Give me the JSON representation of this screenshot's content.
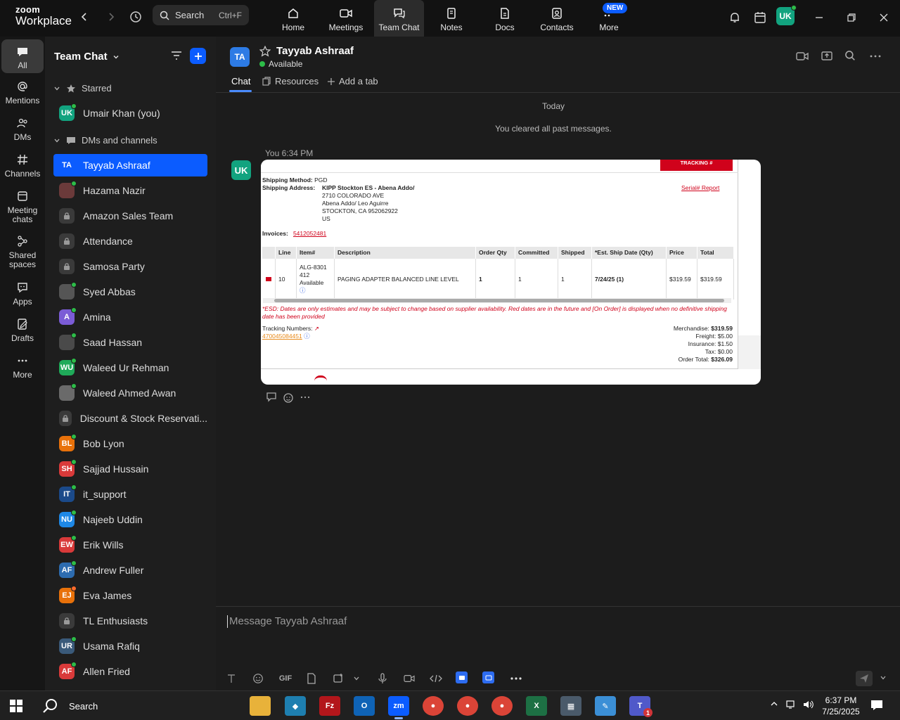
{
  "topbar": {
    "logo_line1": "zoom",
    "logo_line2": "Workplace",
    "search_label": "Search",
    "search_shortcut": "Ctrl+F",
    "tabs": [
      {
        "label": "Home",
        "icon": "home-icon"
      },
      {
        "label": "Meetings",
        "icon": "video-icon"
      },
      {
        "label": "Team Chat",
        "icon": "chat-icon"
      },
      {
        "label": "Notes",
        "icon": "notes-icon"
      },
      {
        "label": "Docs",
        "icon": "docs-icon"
      },
      {
        "label": "Contacts",
        "icon": "contacts-icon"
      },
      {
        "label": "More",
        "icon": "more-icon"
      }
    ],
    "new_badge": "NEW",
    "user_initials": "UK",
    "brand_color": "#0b5cff"
  },
  "rail": [
    {
      "label": "All"
    },
    {
      "label": "Mentions"
    },
    {
      "label": "DMs"
    },
    {
      "label": "Channels"
    },
    {
      "label": "Meeting chats"
    },
    {
      "label": "Shared spaces"
    },
    {
      "label": "Apps"
    },
    {
      "label": "Drafts"
    },
    {
      "label": "More"
    }
  ],
  "sidebar": {
    "title": "Team Chat",
    "starred_label": "Starred",
    "dms_label": "DMs and channels",
    "starred_item": {
      "name": "Umair Khan (you)",
      "initials": "UK",
      "color": "#12a37f"
    },
    "items": [
      {
        "name": "Tayyab Ashraaf",
        "initials": "TA",
        "color": "#0b5cff",
        "type": "avatar",
        "selected": true
      },
      {
        "name": "Hazama Nazir",
        "initials": "",
        "color": "#6b3a3a",
        "type": "photo"
      },
      {
        "name": "Amazon Sales Team",
        "type": "lock"
      },
      {
        "name": "Attendance",
        "type": "lock"
      },
      {
        "name": "Samosa Party",
        "type": "lock"
      },
      {
        "name": "Syed Abbas",
        "initials": "",
        "color": "#555",
        "type": "photo"
      },
      {
        "name": "Amina",
        "initials": "A",
        "color": "#7b5cd6",
        "type": "avatar"
      },
      {
        "name": "Saad Hassan",
        "initials": "",
        "color": "#4a4a4a",
        "type": "photo"
      },
      {
        "name": "Waleed Ur Rehman",
        "initials": "WU",
        "color": "#1faa59",
        "type": "avatar"
      },
      {
        "name": "Waleed Ahmed Awan",
        "initials": "",
        "color": "#6a6a6a",
        "type": "photo"
      },
      {
        "name": "Discount & Stock Reservati...",
        "type": "lock"
      },
      {
        "name": "Bob Lyon",
        "initials": "BL",
        "color": "#e8710a",
        "type": "avatar"
      },
      {
        "name": "Sajjad Hussain",
        "initials": "SH",
        "color": "#d93a3a",
        "type": "avatar"
      },
      {
        "name": "it_support",
        "initials": "IT",
        "color": "#1b4a8a",
        "type": "photo"
      },
      {
        "name": "Najeeb Uddin",
        "initials": "NU",
        "color": "#1e88e5",
        "type": "avatar"
      },
      {
        "name": "Erik Wills",
        "initials": "EW",
        "color": "#d93a3a",
        "type": "avatar"
      },
      {
        "name": "Andrew Fuller",
        "initials": "AF",
        "color": "#2d6cb0",
        "type": "avatar"
      },
      {
        "name": "Eva James",
        "initials": "EJ",
        "color": "#e8710a",
        "type": "avatar",
        "status": "orange"
      },
      {
        "name": "TL Enthusiasts",
        "type": "lock"
      },
      {
        "name": "Usama Rafiq",
        "initials": "UR",
        "color": "#3a5a7a",
        "type": "avatar"
      },
      {
        "name": "Allen Fried",
        "initials": "AF",
        "color": "#d93a3a",
        "type": "avatar"
      }
    ]
  },
  "chat": {
    "contact_name": "Tayyab Ashraaf",
    "contact_initials": "TA",
    "status": "Available",
    "tabs": [
      "Chat",
      "Resources",
      "Add a tab"
    ],
    "day_label": "Today",
    "cleared_notice": "You cleared all past messages.",
    "message_meta": "You 6:34 PM",
    "sender_initials": "UK",
    "composer_placeholder": "Message Tayyab Ashraaf"
  },
  "order": {
    "tracking_btn": "TRACKING #",
    "shipping_method_label": "Shipping Method:",
    "shipping_method": "PGD",
    "shipping_address_label": "Shipping Address:",
    "address_line1": "KIPP Stockton ES - Abena Addo/",
    "address_line2": "2710 COLORADO AVE",
    "address_line3": "Abena Addo/ Leo Aguirre",
    "address_line4": "STOCKTON, CA 952062922",
    "address_line5": "US",
    "serial_report": "Serial# Report",
    "invoices_label": "Invoices:",
    "invoice_no": "5412052481",
    "headers": [
      "Line",
      "Item#",
      "Description",
      "Order Qty",
      "Committed",
      "Shipped",
      "*Est. Ship Date (Qty)",
      "Price",
      "Total"
    ],
    "row": {
      "line": "10",
      "item_l1": "ALG-8301",
      "item_l2": "412",
      "item_l3": "Available",
      "description": "PAGING ADAPTER BALANCED LINE LEVEL",
      "order_qty": "1",
      "committed": "1",
      "shipped": "1",
      "ship_date": "7/24/25 (1)",
      "price": "$319.59",
      "total": "$319.59"
    },
    "esd_note": "*ESD: Dates are only estimates and may be subject to change based on supplier availability. Red dates are in the future and [On Order] is displayed when no definitive shipping date has been provided",
    "tracking_label": "Tracking Numbers:",
    "tracking_number": "470045084451",
    "merch_label": "Merchandise:",
    "merch": "$319.59",
    "freight_label": "Freight:",
    "freight": "$5.00",
    "insurance_label": "Insurance:",
    "insurance": "$1.50",
    "tax_label": "Tax:",
    "tax": "$0.00",
    "total_label": "Order Total:",
    "total": "$326.09"
  },
  "taskbar": {
    "search_label": "Search",
    "time": "6:37 PM",
    "date": "7/25/2025",
    "teams_badge": "1"
  }
}
